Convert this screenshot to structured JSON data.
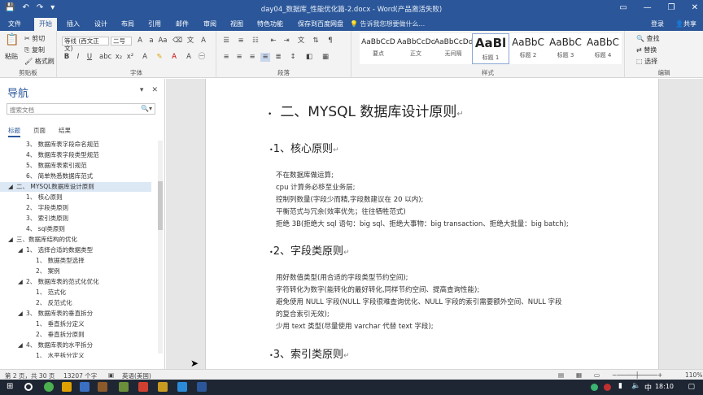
{
  "titlebar": {
    "title": "day04_数据库_性能优化篇-2.docx - Word(产品激活失败)",
    "qat": [
      "💾",
      "↶",
      "↷",
      "▾"
    ],
    "win": [
      "▭",
      "—",
      "❐",
      "✕"
    ]
  },
  "tabs": [
    "文件",
    "开始",
    "插入",
    "设计",
    "布局",
    "引用",
    "邮件",
    "审阅",
    "视图",
    "特色功能",
    "保存到百度网盘"
  ],
  "tellme": "告诉我您想要做什么...",
  "account": {
    "login": "登录",
    "share": "共享"
  },
  "ribbon": {
    "clipboard": {
      "paste": "粘贴",
      "cut": "剪切",
      "copy": "复制",
      "format_painter": "格式刷",
      "label": "剪贴板"
    },
    "font": {
      "name": "等线 (西文正文)",
      "size": "二号",
      "label": "字体"
    },
    "paragraph": {
      "label": "段落"
    },
    "styles": {
      "items": [
        {
          "sample": "AaBbCcD",
          "name": "要点"
        },
        {
          "sample": "AaBbCcDd",
          "name": "正文"
        },
        {
          "sample": "AaBbCcDd",
          "name": "无间隔"
        },
        {
          "sample": "AaBl",
          "name": "标题 1"
        },
        {
          "sample": "AaBbC",
          "name": "标题 2"
        },
        {
          "sample": "AaBbC",
          "name": "标题 3"
        },
        {
          "sample": "AaBbC",
          "name": "标题 4"
        }
      ],
      "label": "样式"
    },
    "editing": {
      "find": "查找",
      "replace": "替换",
      "select": "选择",
      "label": "编辑"
    }
  },
  "nav": {
    "title": "导航",
    "search_placeholder": "搜索文档",
    "tabs": [
      "标题",
      "页面",
      "结果"
    ],
    "items": [
      "3、 数据库表字段命名规范",
      "4、 数据库表字段类型规范",
      "5、 数据库表索引规范",
      "6、 简单熟悉数据库范式",
      "二、 MYSQL数据库设计原则",
      "1、 核心原则",
      "2、 字段类原则",
      "3、 索引类原则",
      "4、 sql类原则",
      "三、数据库结构的优化",
      "1、 选择合适的数据类型",
      "1、 数据类型选择",
      "2、 案例",
      "2、 数据库表的范式化优化",
      "1、 范式化",
      "2、 反范式化",
      "3、 数据库表的垂直拆分",
      "1、 垂直拆分定义",
      "2、 垂直拆分原则",
      "4、 数据库表的水平拆分",
      "1、 水平拆分定义"
    ]
  },
  "document": {
    "heading1": "二、MYSQL 数据库设计原则",
    "sections": [
      {
        "title": "1、核心原则",
        "lines": [
          "不在数据库做运算;",
          "cpu 计算务必移至业务层;",
          "控制列数量(字段少而精,字段数建议在 20 以内);",
          "平衡范式与冗余(效率优先；往往牺牲范式)",
          "拒绝 3B(拒绝大 sql 语句：big sql、拒绝大事物：big transaction、拒绝大批量：big batch);"
        ]
      },
      {
        "title": "2、字段类原则",
        "lines": [
          "用好数值类型(用合适的字段类型节约空间);",
          "字符转化为数字(能转化的最好转化,同样节约空间、提高查询性能);",
          "避免使用 NULL 字段(NULL 字段很难查询优化、NULL 字段的索引需要额外空间、NULL 字段",
          "的复合索引无效);",
          "少用 text 类型(尽量使用 varchar 代替 text 字段);"
        ]
      },
      {
        "title": "3、索引类原则",
        "lines": []
      }
    ]
  },
  "status": {
    "page": "第 2 页，共 30 页",
    "words": "13207 个字",
    "lang": "英语(美国)",
    "zoom": "110%"
  },
  "taskbar": {
    "time": "18:10"
  }
}
